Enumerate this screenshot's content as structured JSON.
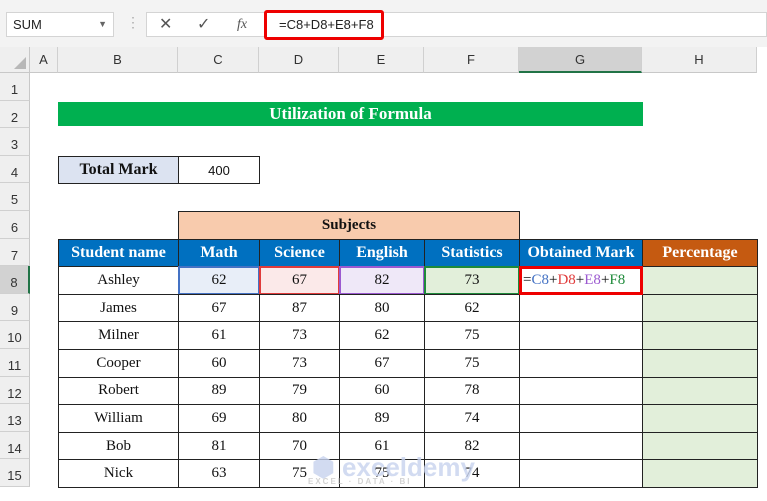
{
  "formula_bar": {
    "name_box": "SUM",
    "cancel_icon": "✕",
    "enter_icon": "✓",
    "fx_icon": "fx",
    "formula": "=C8+D8+E8+F8"
  },
  "columns": [
    "A",
    "B",
    "C",
    "D",
    "E",
    "F",
    "G",
    "H"
  ],
  "rows": [
    "1",
    "2",
    "3",
    "4",
    "5",
    "6",
    "7",
    "8",
    "9",
    "10",
    "11",
    "12",
    "13",
    "14",
    "15"
  ],
  "title": "Utilization of Formula",
  "total_mark": {
    "label": "Total Mark",
    "value": "400"
  },
  "subjects_label": "Subjects",
  "headers": [
    "Student name",
    "Math",
    "Science",
    "English",
    "Statistics",
    "Obtained Mark",
    "Percentage"
  ],
  "students": [
    {
      "name": "Ashley",
      "values": [
        "62",
        "67",
        "82",
        "73"
      ]
    },
    {
      "name": "James",
      "values": [
        "67",
        "87",
        "80",
        "62"
      ]
    },
    {
      "name": "Milner",
      "values": [
        "61",
        "73",
        "62",
        "75"
      ]
    },
    {
      "name": "Cooper",
      "values": [
        "60",
        "73",
        "67",
        "75"
      ]
    },
    {
      "name": "Robert",
      "values": [
        "89",
        "79",
        "60",
        "78"
      ]
    },
    {
      "name": "William",
      "values": [
        "69",
        "80",
        "89",
        "74"
      ]
    },
    {
      "name": "Bob",
      "values": [
        "81",
        "70",
        "61",
        "82"
      ]
    },
    {
      "name": "Nick",
      "values": [
        "63",
        "75",
        "75",
        "74"
      ]
    }
  ],
  "edit_formula": {
    "eq": "=",
    "parts": [
      "C8",
      "D8",
      "E8",
      "F8"
    ],
    "plus": "+"
  },
  "colors": {
    "green": "#00b050",
    "blue": "#0070c0",
    "orange": "#c55a11",
    "peach": "#f8cbad",
    "light_green": "#e2efda",
    "refs": [
      "#4472c4",
      "#e03b3b",
      "#9b59d0",
      "#1e8a3a"
    ]
  },
  "watermark": {
    "brand": "exceldemy",
    "tagline": "EXCEL · DATA · BI"
  }
}
